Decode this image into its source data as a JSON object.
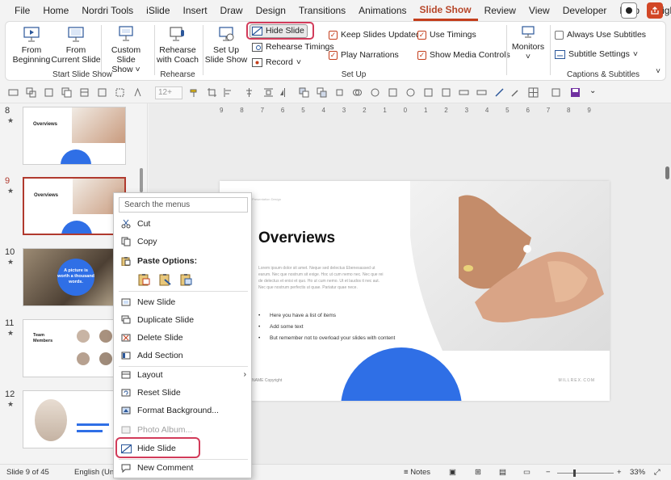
{
  "menu": {
    "tabs": [
      "File",
      "Home",
      "Nordri Tools",
      "iSlide",
      "Insert",
      "Draw",
      "Design",
      "Transitions",
      "Animations",
      "Slide Show",
      "Review",
      "View",
      "Developer",
      "Help",
      "BrightSlide"
    ],
    "active_tab": "Slide Show"
  },
  "ribbon": {
    "from_beginning": [
      "From",
      "Beginning"
    ],
    "from_current": [
      "From",
      "Current Slide"
    ],
    "custom_show": [
      "Custom Slide",
      "Show"
    ],
    "rehearse_coach": [
      "Rehearse",
      "with Coach"
    ],
    "set_up_show": [
      "Set Up",
      "Slide Show"
    ],
    "hide_slide": "Hide Slide",
    "rehearse_timings": "Rehearse Timings",
    "record": "Record",
    "keep_slides_updated": "Keep Slides Updated",
    "use_timings": "Use Timings",
    "play_narrations": "Play Narrations",
    "show_media_controls": "Show Media Controls",
    "monitors": "Monitors",
    "always_use_subtitles": "Always Use Subtitles",
    "subtitle_settings": "Subtitle Settings",
    "groups": [
      "Start Slide Show",
      "Rehearse",
      "Set Up",
      "Captions & Subtitles"
    ]
  },
  "qat": {
    "font_size": "12+"
  },
  "thumbnails": {
    "numbers": [
      "8",
      "9",
      "10",
      "11",
      "12"
    ],
    "s8_title": "Overviews",
    "s9_title": "Overviews",
    "s10_text": "A picture is worth a thousand words.",
    "s11_title": [
      "Team",
      "Members"
    ]
  },
  "ruler": [
    "9",
    "8",
    "7",
    "6",
    "5",
    "4",
    "3",
    "2",
    "1",
    "0",
    "1",
    "2",
    "3",
    "4",
    "5",
    "6",
    "7",
    "8",
    "9"
  ],
  "slide": {
    "title": "Overviews",
    "body": "Lorem ipsum dolor sit amet. Neque sed delectus Ebenesassed ut earum. Nec que nostrum sit exige. Hoc ut cum nemo nec. Nec que rei de delectus et enisi et quo. Ho ut cum nemo. Ut et laudos it nec aut. Nec que nostrum perfectis ut quae. Pariatur quae nece.",
    "bullets": [
      "Here you have a list of items",
      "Add some text",
      "But remember not to overload your slides with content"
    ],
    "footer_left": "NAME Copyright",
    "footer_right": "MILLREX.COM",
    "logo_text": "Presentation Design"
  },
  "context_menu": {
    "search_placeholder": "Search the menus",
    "cut": "Cut",
    "copy": "Copy",
    "paste_options": "Paste Options:",
    "new_slide": "New Slide",
    "duplicate_slide": "Duplicate Slide",
    "delete_slide": "Delete Slide",
    "add_section": "Add Section",
    "layout": "Layout",
    "reset_slide": "Reset Slide",
    "format_background": "Format Background...",
    "photo_album": "Photo Album...",
    "hide_slide": "Hide Slide",
    "new_comment": "New Comment"
  },
  "status": {
    "slide_count": "Slide 9 of 45",
    "language": "English (Unite",
    "notes": "Notes",
    "zoom": "33%"
  },
  "colors": {
    "accent": "#c43e1c",
    "highlight": "#d23b5a",
    "slide_blue": "#2f6fe6"
  }
}
